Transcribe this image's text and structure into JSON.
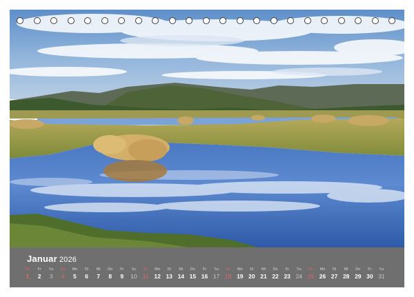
{
  "calendar": {
    "month": "Januar",
    "year": "2026",
    "days": [
      {
        "wd": "Do",
        "d": "1",
        "weekend": false,
        "holiday": true
      },
      {
        "wd": "Fr",
        "d": "2",
        "weekend": false,
        "holiday": false
      },
      {
        "wd": "Sa",
        "d": "3",
        "weekend": true,
        "holiday": false
      },
      {
        "wd": "So",
        "d": "4",
        "weekend": true,
        "holiday": true
      },
      {
        "wd": "Mo",
        "d": "5",
        "weekend": false,
        "holiday": false
      },
      {
        "wd": "Di",
        "d": "6",
        "weekend": false,
        "holiday": false
      },
      {
        "wd": "Mi",
        "d": "7",
        "weekend": false,
        "holiday": false
      },
      {
        "wd": "Do",
        "d": "8",
        "weekend": false,
        "holiday": false
      },
      {
        "wd": "Fr",
        "d": "9",
        "weekend": false,
        "holiday": false
      },
      {
        "wd": "Sa",
        "d": "10",
        "weekend": true,
        "holiday": false
      },
      {
        "wd": "So",
        "d": "11",
        "weekend": true,
        "holiday": true
      },
      {
        "wd": "Mo",
        "d": "12",
        "weekend": false,
        "holiday": false
      },
      {
        "wd": "Di",
        "d": "13",
        "weekend": false,
        "holiday": false
      },
      {
        "wd": "Mi",
        "d": "14",
        "weekend": false,
        "holiday": false
      },
      {
        "wd": "Do",
        "d": "15",
        "weekend": false,
        "holiday": false
      },
      {
        "wd": "Fr",
        "d": "16",
        "weekend": false,
        "holiday": false
      },
      {
        "wd": "Sa",
        "d": "17",
        "weekend": true,
        "holiday": false
      },
      {
        "wd": "So",
        "d": "18",
        "weekend": true,
        "holiday": true
      },
      {
        "wd": "Mo",
        "d": "19",
        "weekend": false,
        "holiday": false
      },
      {
        "wd": "Di",
        "d": "20",
        "weekend": false,
        "holiday": false
      },
      {
        "wd": "Mi",
        "d": "21",
        "weekend": false,
        "holiday": false
      },
      {
        "wd": "Do",
        "d": "22",
        "weekend": false,
        "holiday": false
      },
      {
        "wd": "Fr",
        "d": "23",
        "weekend": false,
        "holiday": false
      },
      {
        "wd": "Sa",
        "d": "24",
        "weekend": true,
        "holiday": false
      },
      {
        "wd": "So",
        "d": "25",
        "weekend": true,
        "holiday": true
      },
      {
        "wd": "Mo",
        "d": "26",
        "weekend": false,
        "holiday": false
      },
      {
        "wd": "Di",
        "d": "27",
        "weekend": false,
        "holiday": false
      },
      {
        "wd": "Mi",
        "d": "28",
        "weekend": false,
        "holiday": false
      },
      {
        "wd": "Do",
        "d": "29",
        "weekend": false,
        "holiday": false
      },
      {
        "wd": "Fr",
        "d": "30",
        "weekend": false,
        "holiday": false
      },
      {
        "wd": "Sa",
        "d": "31",
        "weekend": true,
        "holiday": false
      }
    ]
  },
  "colors": {
    "calendar_bar": "#6f6f6f",
    "holiday": "#e06666"
  }
}
